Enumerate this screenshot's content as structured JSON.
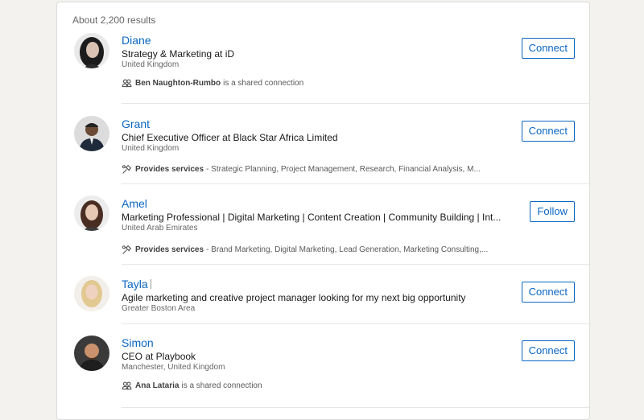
{
  "search": {
    "result_count": "About 2,200 results"
  },
  "results": [
    {
      "name": "Diane",
      "headline": "Strategy & Marketing at iD",
      "location": "United Kingdom",
      "insight_icon": "people-icon",
      "insight_bold": "Ben Naughton-Rumbo",
      "insight_text": "is a shared connection",
      "action": "Connect"
    },
    {
      "name": "Grant",
      "headline": "Chief Executive Officer at Black Star Africa Limited",
      "location": "United Kingdom",
      "insight_icon": "services-icon",
      "insight_bold": "Provides services",
      "insight_text": "- Strategic Planning, Project Management, Research, Financial Analysis, M...",
      "action": "Connect"
    },
    {
      "name": "Amel",
      "headline": "Marketing Professional | Digital Marketing | Content Creation | Community Building | Int...",
      "location": "United Arab Emirates",
      "insight_icon": "services-icon",
      "insight_bold": "Provides services",
      "insight_text": "- Brand Marketing, Digital Marketing, Lead Generation, Marketing Consulting,...",
      "action": "Follow"
    },
    {
      "name": "Tayla",
      "headline": "Agile marketing and creative project manager looking for my next big opportunity",
      "location": "Greater Boston Area",
      "action": "Connect"
    },
    {
      "name": "Simon",
      "headline": "CEO at Playbook",
      "location": "Manchester, United Kingdom",
      "insight_icon": "people-icon",
      "insight_bold": "Ana Lataria",
      "insight_text": "is a shared connection",
      "action": "Connect"
    }
  ]
}
